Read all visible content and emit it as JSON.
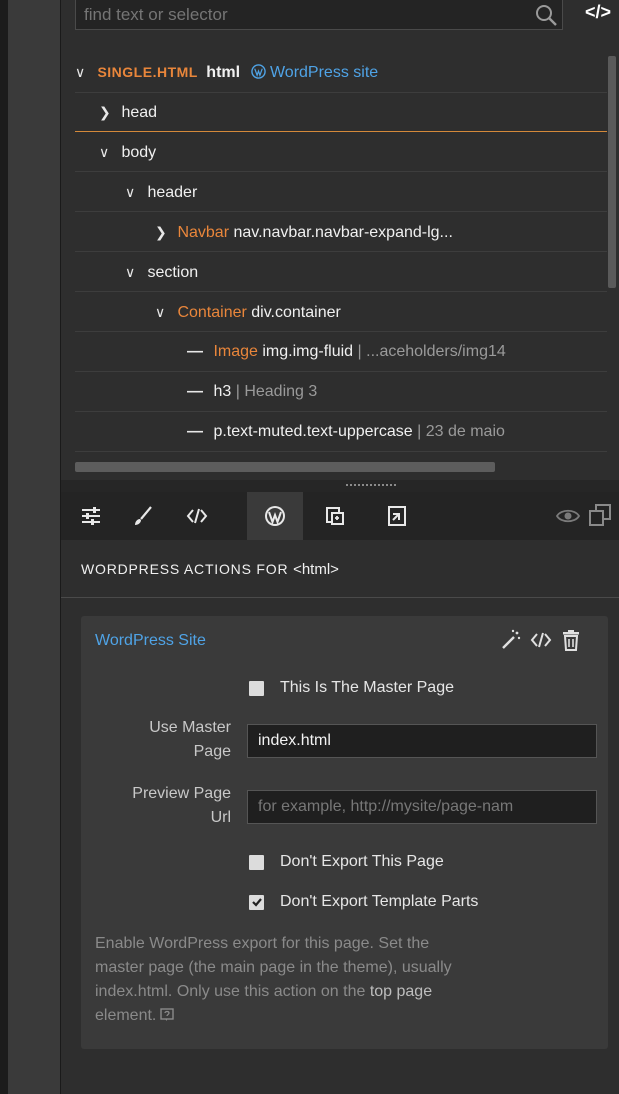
{
  "search": {
    "placeholder": "find text or selector"
  },
  "tree": {
    "rows": [
      {
        "name": "SINGLE.HTML",
        "tag": "html",
        "badge": "WordPress site"
      },
      {
        "tag": "head"
      },
      {
        "tag": "body"
      },
      {
        "tag": "header"
      },
      {
        "label": "Navbar",
        "tag": "nav.navbar.navbar-expand-lg..."
      },
      {
        "tag": "section"
      },
      {
        "label": "Container",
        "tag": "div.container"
      },
      {
        "label": "Image",
        "tag": "img.img-fluid",
        "extra": "...aceholders/img14"
      },
      {
        "tag": "h3",
        "extra": "Heading 3"
      },
      {
        "tag": "p.text-muted.text-uppercase",
        "extra": "23 de maio"
      }
    ],
    "separator": "|"
  },
  "tabs": [
    {
      "icon": "sliders-icon"
    },
    {
      "icon": "brush-icon"
    },
    {
      "icon": "code-icon"
    },
    {
      "icon": "wordpress-icon",
      "active": true
    },
    {
      "icon": "component-icon"
    },
    {
      "icon": "export-icon"
    }
  ],
  "section": {
    "title": "WORDPRESS ACTIONS FOR",
    "element": "<html>"
  },
  "card": {
    "title": "WordPress Site",
    "master_page_checkbox": {
      "label": "This Is The Master Page",
      "checked": false
    },
    "use_master_page": {
      "label_line1": "Use Master",
      "label_line2": "Page",
      "value": "index.html"
    },
    "preview_url": {
      "label_line1": "Preview Page",
      "label_line2": "Url",
      "placeholder": "for example, http://mysite/page-nam"
    },
    "dont_export_page": {
      "label": "Don't Export This Page",
      "checked": false
    },
    "dont_export_parts": {
      "label": "Don't Export Template Parts",
      "checked": true
    },
    "help": {
      "line1": "Enable WordPress export for this page. Set the",
      "line2": "master page (the main page in the theme), usually",
      "line3_a": "index.html. Only use this action on the ",
      "line3_b": "top page",
      "line4": "element."
    }
  },
  "colors": {
    "accent_orange": "#e9863b",
    "accent_blue": "#4fa3e6",
    "background": "#2e2e2e",
    "card": "#3a3a3a"
  }
}
